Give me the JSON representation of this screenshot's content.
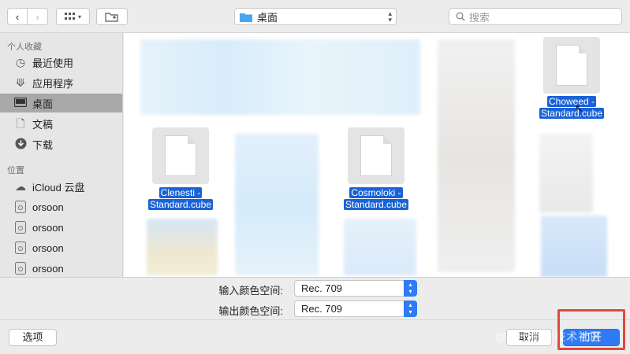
{
  "toolbar": {
    "back_icon": "chevron-left-icon",
    "forward_icon": "chevron-right-icon",
    "view_icon": "grid-view-icon",
    "new_folder_icon": "new-folder-icon",
    "path_label": "桌面",
    "search_placeholder": "搜索"
  },
  "sidebar": {
    "favorites_heading": "个人收藏",
    "favorites": [
      {
        "label": "最近使用",
        "icon": "clock-icon"
      },
      {
        "label": "应用程序",
        "icon": "applications-icon"
      },
      {
        "label": "桌面",
        "icon": "desktop-icon",
        "selected": true
      },
      {
        "label": "文稿",
        "icon": "document-icon"
      },
      {
        "label": "下载",
        "icon": "download-icon"
      }
    ],
    "locations_heading": "位置",
    "locations": [
      {
        "label": "iCloud 云盘",
        "icon": "cloud-icon"
      },
      {
        "label": "orsoon",
        "icon": "disk-icon"
      },
      {
        "label": "orsoon",
        "icon": "disk-icon"
      },
      {
        "label": "orsoon",
        "icon": "disk-icon"
      },
      {
        "label": "orsoon",
        "icon": "disk-icon"
      }
    ]
  },
  "files": [
    {
      "line1": "Choweed -",
      "line2": "Standard.cube"
    },
    {
      "line1": "Clenesti -",
      "line2": "Standard.cube"
    },
    {
      "line1": "Cosmoloki -",
      "line2": "Standard.cube"
    }
  ],
  "accessory": {
    "input_label": "输入颜色空间:",
    "input_value": "Rec. 709",
    "output_label": "输出颜色空间:",
    "output_value": "Rec. 709"
  },
  "footer": {
    "options_label": "选项",
    "cancel_label": "取消",
    "open_label": "打开",
    "watermark": "@稀土掘金技术社区"
  },
  "colors": {
    "accent": "#2f7bf5",
    "selection": "#1a62d8",
    "highlight_box": "#e0483f"
  }
}
